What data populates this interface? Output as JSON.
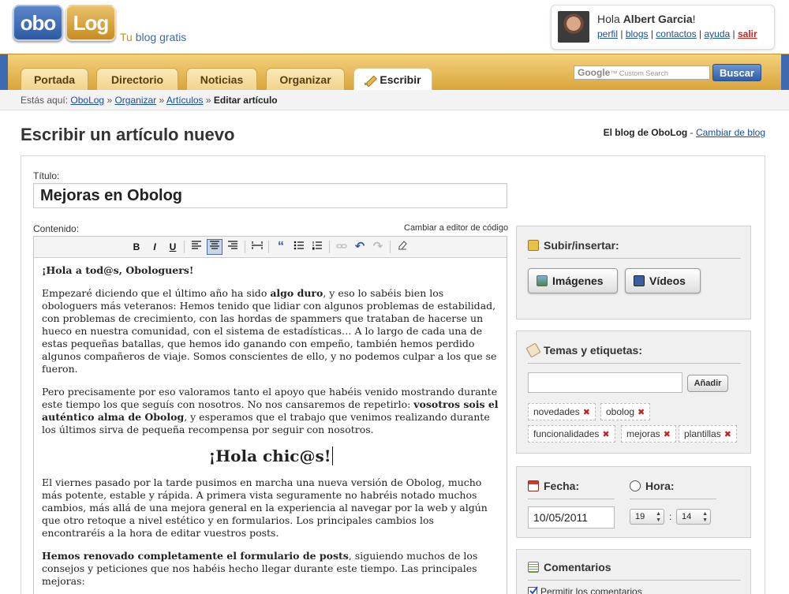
{
  "header": {
    "logo_left": "obo",
    "logo_right": "Log",
    "tagline_prefix": "Tu ",
    "tagline_suffix": "blog gratis",
    "greeting": "Hola ",
    "user_name": "Albert Garcia",
    "greeting_end": "!",
    "links": [
      "perfil",
      "blogs",
      "contactos",
      "ayuda",
      "salir"
    ]
  },
  "nav": {
    "tabs": [
      "Portada",
      "Directorio",
      "Noticias",
      "Organizar",
      "Escribir"
    ],
    "search_placeholder": "Custom Search",
    "search_brand": "Google",
    "search_button": "Buscar"
  },
  "breadcrumb": {
    "prefix": "Estás aquí:",
    "items": [
      "OboLog",
      "Organizar",
      "Artículos"
    ],
    "current": "Editar artículo",
    "sep": "»"
  },
  "page": {
    "title": "Escribir un artículo nuevo",
    "blog_label": "El blog de OboLog",
    "change_blog": "Cambiar de blog"
  },
  "form": {
    "title_label": "Título:",
    "title_value": "Mejoras en Obolog",
    "content_label": "Contenido:",
    "code_editor_link": "Cambiar a editor de código"
  },
  "toolbar": {
    "bold": "B",
    "italic": "I",
    "underline": "U",
    "quote": "“",
    "undo": "↶",
    "redo": "↷"
  },
  "content": {
    "greeting": "¡Hola a tod@s, Obologuers!",
    "p1_a": "Empezaré diciendo que el último año ha sido ",
    "p1_b": "algo duro",
    "p1_c": ", y eso lo sabéis bien los obologuers más veteranos: Hemos tenido que lidiar con algunos problemas de estabilidad, con problemas de crecimiento, con las hordas de spammers que trataban de hacerse un hueco en nuestra comunidad, con el sistema de estadísticas… A lo largo de cada una de estas pequeñas batallas, que hemos ido ganando con empeño, también hemos perdido algunos compañeros de viaje. Somos conscientes de ello, y no podemos culpar a los que se fueron.",
    "p2_a": "Pero precisamente por eso valoramos tanto el apoyo que habéis venido mostrando durante este tiempo los que seguís con nosotros. No nos cansaremos de repetirlo: ",
    "p2_b": "vosotros sois el auténtico alma de Obolog",
    "p2_c": ", y esperamos que el trabajo que venimos realizando durante los últimos sirva de pequeña recompensa por seguir con nosotros.",
    "heading": "¡Hola chic@s!",
    "p3": "El viernes pasado por la tarde pusimos en marcha una nueva versión de Obolog, mucho más potente, estable y rápida. A primera vista seguramente no habréis notado muchos cambios, más allá de una mejora general en la experiencia al navegar por la web y algún que otro retoque a nivel estético y en formularios. Los principales cambios los encontraréis a la hora de editar vuestros posts.",
    "p4_a": "Hemos renovado completamente el formulario de posts",
    "p4_b": ", siguiendo muchos de los consejos y peticiones que nos habéis hecho llegar durante este tiempo. Las principales mejoras:"
  },
  "sidebar": {
    "upload_title": "Subir/insertar:",
    "images_button": "Imágenes",
    "videos_button": "Vídeos",
    "tags_title": "Temas y etiquetas:",
    "add_button": "Añadir",
    "tags": [
      "novedades",
      "obolog",
      "funcionalidades",
      "mejoras",
      "plantillas"
    ],
    "date_title": "Fecha:",
    "date_value": "10/05/2011",
    "time_title": "Hora:",
    "hour": "19",
    "minute": "14",
    "time_sep": ":",
    "comments_title": "Comentarios",
    "allow_comments": "Permitir los comentarios"
  }
}
